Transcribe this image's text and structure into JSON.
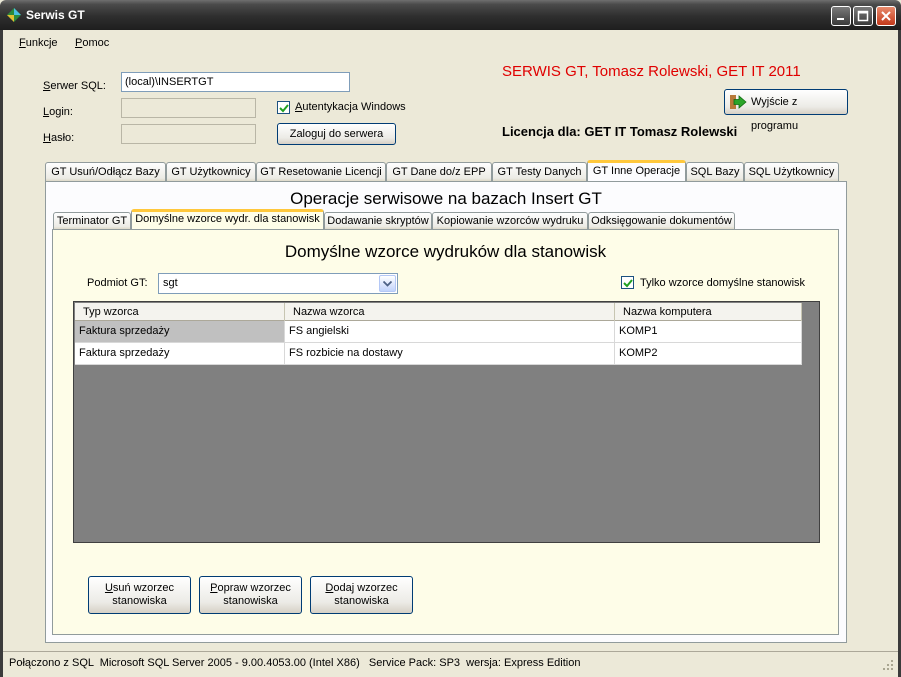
{
  "window": {
    "title": "Serwis GT"
  },
  "menu": {
    "items": [
      "Funkcje",
      "Pomoc"
    ]
  },
  "login": {
    "server_label": "Serwer SQL:",
    "server_value": "(local)\\INSERTGT",
    "login_label": "Login:",
    "login_value": "",
    "password_label": "Hasło:",
    "password_value": "",
    "windows_auth_label": "Autentykacja Windows",
    "windows_auth_checked": true,
    "connect_button": "Zaloguj do serwera"
  },
  "brand": {
    "title": "SERWIS GT, Tomasz Rolewski, GET IT 2011",
    "exit_button": "Wyjście z programu",
    "license": "Licencja dla: GET IT Tomasz Rolewski",
    "accent_color": "#e00000"
  },
  "main_tabs": [
    "GT Usuń/Odłącz Bazy",
    "GT Użytkownicy",
    "GT Resetowanie Licencji",
    "GT Dane do/z EPP",
    "GT Testy Danych",
    "GT Inne Operacje",
    "SQL Bazy",
    "SQL Użytkownicy"
  ],
  "main_tab_active": "GT Inne Operacje",
  "section_title": "Operacje serwisowe na bazach Insert GT",
  "inner_tabs": [
    "Terminator GT",
    "Domyślne wzorce wydr. dla stanowisk",
    "Dodawanie skryptów",
    "Kopiowanie wzorców wydruku",
    "Odksięgowanie dokumentów"
  ],
  "inner_tab_active": "Domyślne wzorce wydr. dla stanowisk",
  "panel": {
    "title": "Domyślne wzorce wydruków dla stanowisk",
    "subject_label": "Podmiot GT:",
    "subject_value": "sgt",
    "only_default_label": "Tylko wzorce domyślne stanowisk",
    "only_default_checked": true
  },
  "grid": {
    "columns": [
      "Typ wzorca",
      "Nazwa wzorca",
      "Nazwa komputera"
    ],
    "rows": [
      [
        "Faktura sprzedaży",
        "FS angielski",
        "KOMP1"
      ],
      [
        "Faktura sprzedaży",
        "FS rozbicie na dostawy",
        "KOMP2"
      ]
    ]
  },
  "actions": {
    "delete": [
      "Usuń wzorzec",
      "stanowiska"
    ],
    "edit": [
      "Popraw wzorzec",
      "stanowiska"
    ],
    "add": [
      "Dodaj wzorzec",
      "stanowiska"
    ]
  },
  "status": {
    "text": "Połączono z SQL  Microsoft SQL Server 2005 - 9.00.4053.00 (Intel X86)   Service Pack: SP3  wersja: Express Edition"
  },
  "icons": [
    "app-icon",
    "minimize-icon",
    "maximize-icon",
    "close-icon",
    "exit-arrow-icon",
    "chevron-down-icon",
    "check-icon",
    "resize-grip-icon"
  ]
}
